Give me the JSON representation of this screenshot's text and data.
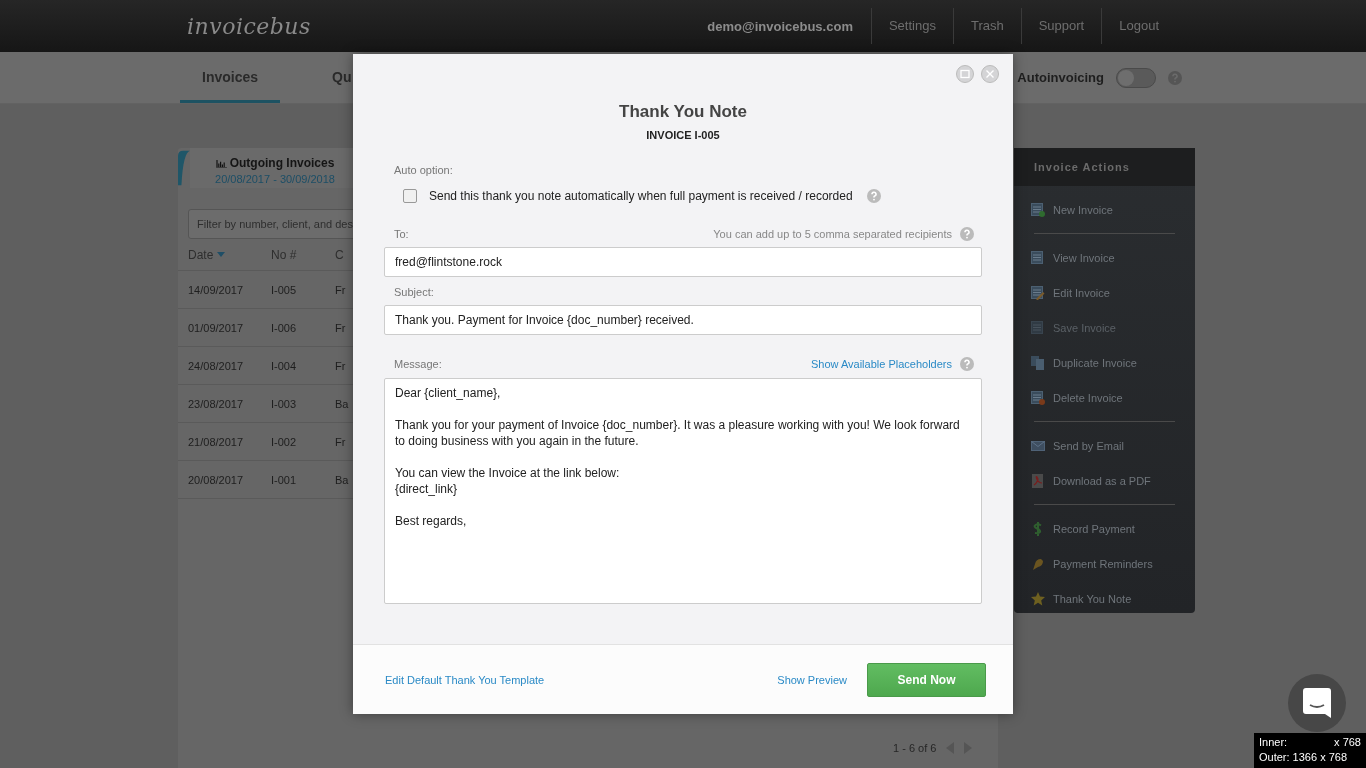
{
  "header": {
    "logo": "invoicebus",
    "user_email": "demo@invoicebus.com",
    "nav": [
      "Settings",
      "Trash",
      "Support",
      "Logout"
    ]
  },
  "subnav": {
    "tabs": [
      {
        "label": "Invoices",
        "selected": true
      },
      {
        "label": "Qu",
        "selected": false
      }
    ],
    "autoinvoicing": {
      "label": "Autoinvoicing",
      "on": false
    }
  },
  "invoice_list": {
    "title": "Outgoing Invoices",
    "date_range": "20/08/2017 - 30/09/2018",
    "filter_placeholder": "Filter by number, client, and des",
    "columns": [
      "Date",
      "No #",
      "C"
    ],
    "rows": [
      {
        "date": "14/09/2017",
        "no": "I-005",
        "client": "Fr"
      },
      {
        "date": "01/09/2017",
        "no": "I-006",
        "client": "Fr"
      },
      {
        "date": "24/08/2017",
        "no": "I-004",
        "client": "Fr"
      },
      {
        "date": "23/08/2017",
        "no": "I-003",
        "client": "Ba"
      },
      {
        "date": "21/08/2017",
        "no": "I-002",
        "client": "Fr"
      },
      {
        "date": "20/08/2017",
        "no": "I-001",
        "client": "Ba"
      }
    ],
    "pagination": "1 - 6 of 6"
  },
  "actions": {
    "title": "Invoice Actions",
    "groups": [
      [
        {
          "label": "New Invoice",
          "disabled": false
        }
      ],
      [
        {
          "label": "View Invoice",
          "disabled": false
        },
        {
          "label": "Edit Invoice",
          "disabled": false
        },
        {
          "label": "Save Invoice",
          "disabled": true
        },
        {
          "label": "Duplicate Invoice",
          "disabled": false
        },
        {
          "label": "Delete Invoice",
          "disabled": false
        }
      ],
      [
        {
          "label": "Send by Email",
          "disabled": false
        },
        {
          "label": "Download as a PDF",
          "disabled": false
        }
      ],
      [
        {
          "label": "Record Payment",
          "disabled": false
        },
        {
          "label": "Payment Reminders",
          "disabled": false
        },
        {
          "label": "Thank You Note",
          "disabled": false
        }
      ]
    ]
  },
  "modal": {
    "title": "Thank You Note",
    "subtitle": "INVOICE I-005",
    "auto_option_label": "Auto option:",
    "auto_checkbox": {
      "label": "Send this thank you note automatically when full payment is received / recorded",
      "checked": false
    },
    "to_label": "To:",
    "to_hint": "You can add up to 5 comma separated recipients",
    "to_value": "fred@flintstone.rock",
    "subject_label": "Subject:",
    "subject_value": "Thank you. Payment for Invoice {doc_number} received.",
    "message_label": "Message:",
    "placeholders_link": "Show Available Placeholders",
    "message": "Dear {client_name},\n\nThank you for your payment of Invoice {doc_number}. It was a pleasure working with you! We look forward to doing business with you again in the future.\n\nYou can view the Invoice at the link below:\n{direct_link}\n\nBest regards,",
    "edit_template_link": "Edit Default Thank You Template",
    "preview_link": "Show Preview",
    "send_button": "Send Now"
  },
  "size_overlay": {
    "inner_label": "Inner:",
    "inner_rest": "x 768",
    "outer": "Outer: 1366 x 768"
  }
}
